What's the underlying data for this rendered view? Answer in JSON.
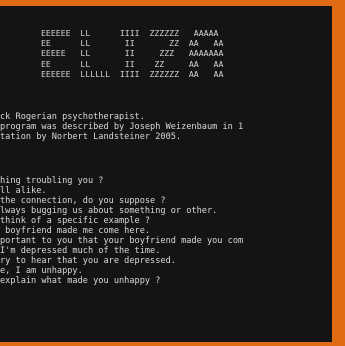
{
  "banner": {
    "lines": [
      "EEEEEE  LL      IIII  ZZZZZZ   AAAAA",
      "EE      LL       II       ZZ  AA   AA",
      "EEEEE   LL       II     ZZZ   AAAAAAA",
      "EE      LL       II    ZZ     AA   AA",
      "EEEEEE  LLLLLL  IIII  ZZZZZZ  AA   AA"
    ]
  },
  "terminal": {
    "intro": [
      "ck Rogerian psychotherapist.",
      "program was described by Joseph Weizenbaum in 1",
      "tation by Norbert Landsteiner 2005."
    ],
    "dialogue": [
      "hing troubling you ?",
      "ll alike.",
      "the connection, do you suppose ?",
      "lways bugging us about something or other.",
      "think of a specific example ?",
      " boyfriend made me come here.",
      "portant to you that your boyfriend made you com",
      "I'm depressed much of the time.",
      "ry to hear that you are depressed.",
      "e, I am unhappy.",
      "explain what made you unhappy ?"
    ]
  }
}
